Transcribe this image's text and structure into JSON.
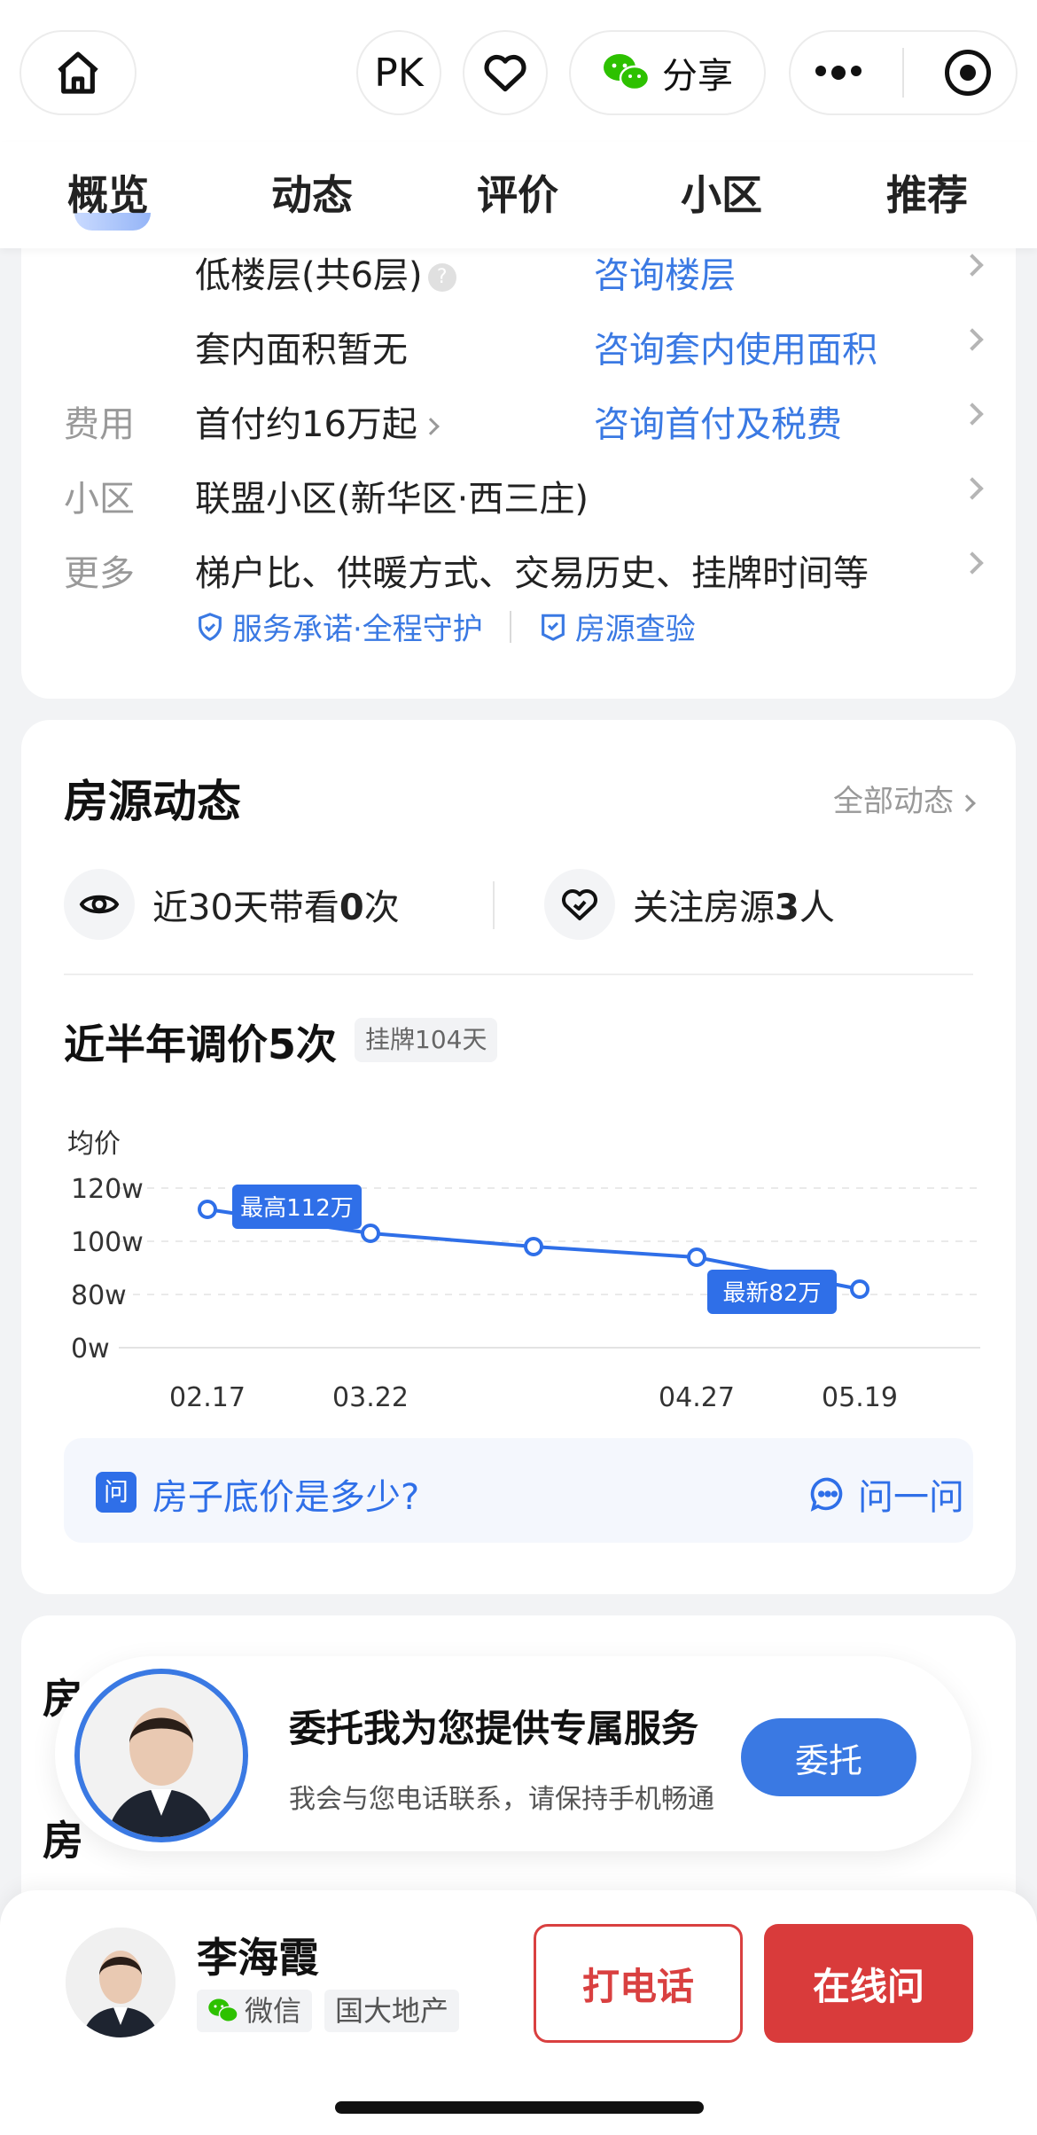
{
  "top_bar": {
    "pk_label": "PK",
    "share_label": "分享"
  },
  "tabs": [
    {
      "label": "概览",
      "active": true
    },
    {
      "label": "动态",
      "active": false
    },
    {
      "label": "评价",
      "active": false
    },
    {
      "label": "小区",
      "active": false
    },
    {
      "label": "推荐",
      "active": false
    }
  ],
  "details": {
    "rows": [
      {
        "label": "",
        "value": "低楼层(共6层)",
        "link": "咨询楼层"
      },
      {
        "label": "",
        "value": "套内面积暂无",
        "link": "咨询套内使用面积"
      },
      {
        "label": "费用",
        "value": "首付约16万起",
        "link": "咨询首付及税费"
      },
      {
        "label": "小区",
        "value": "联盟小区(新华区·西三庄)",
        "link": ""
      },
      {
        "label": "更多",
        "value": "梯户比、供暖方式、交易历史、挂牌时间等",
        "link": ""
      }
    ],
    "service_promise": "服务承诺·全程守护",
    "inspection": "房源查验",
    "qmark": "?"
  },
  "dynamics": {
    "title": "房源动态",
    "all_link": "全部动态",
    "viewings_prefix": "近30天带看",
    "viewings_count": "0",
    "viewings_suffix": "次",
    "followers_prefix": "关注房源",
    "followers_count": "3",
    "followers_suffix": "人",
    "adjust_title": "近半年调价5次",
    "listing_tag": "挂牌104天"
  },
  "chart_data": {
    "type": "line",
    "ylabel": "均价",
    "y_ticks": [
      "120w",
      "100w",
      "80w",
      "0w"
    ],
    "x_tick_labels": [
      "02.17",
      "03.22",
      "",
      "04.27",
      "05.19"
    ],
    "values": [
      112,
      103,
      98,
      94,
      82
    ],
    "annotations": [
      {
        "point": 0,
        "text": "最高112万"
      },
      {
        "point": 4,
        "text": "最新82万"
      }
    ],
    "accent": "#2f6fe8"
  },
  "ask": {
    "icon_text": "问",
    "question": "房子底价是多少?",
    "button": "问一问"
  },
  "agent_service": {
    "section_peek_1": "房",
    "section_peek_2": "房",
    "title": "委托我为您提供专属服务",
    "subtitle": "我会与您电话联系，请保持手机畅通",
    "button": "委托"
  },
  "agent": {
    "name": "李海霞",
    "wechat_tag": "微信",
    "company_tag": "国大地产",
    "call_button": "打电话",
    "online_button": "在线问"
  }
}
